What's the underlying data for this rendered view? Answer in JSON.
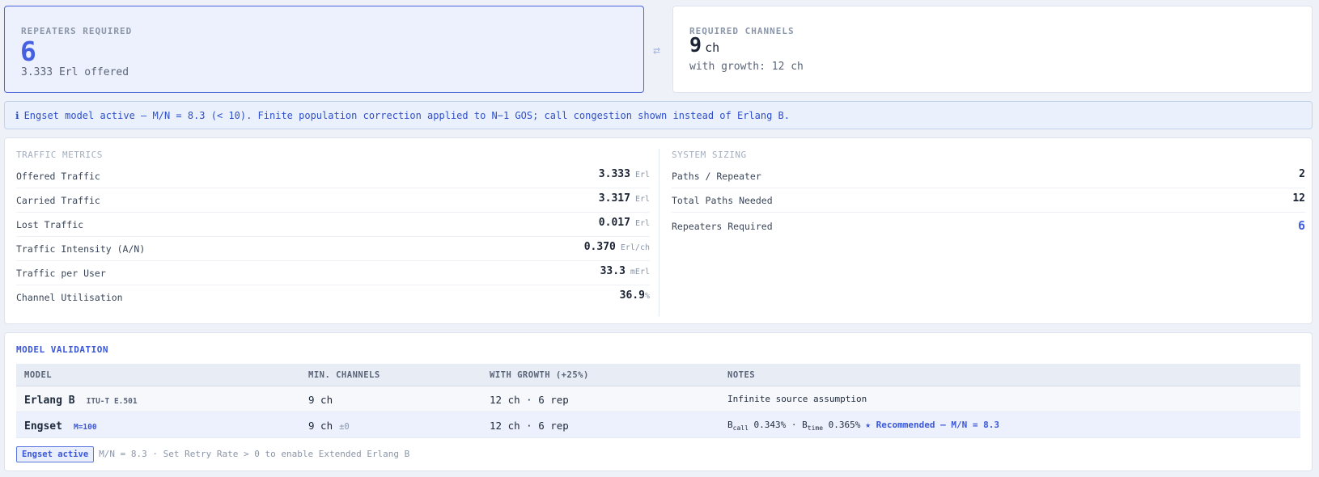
{
  "summary": {
    "repeaters_label": "REPEATERS REQUIRED",
    "repeaters_value": "6",
    "repeaters_sub": "3.333 Erl offered",
    "channels_label": "REQUIRED CHANNELS",
    "channels_value": "9",
    "channels_unit": "ch",
    "channels_sub": "with growth: 12 ch",
    "swap_glyph": "⇄"
  },
  "banner": {
    "icon": "ℹ",
    "text": "Engset model active — M/N = 8.3 (< 10). Finite population correction applied to N−1 GOS; call congestion shown instead of Erlang B."
  },
  "traffic": {
    "title": "TRAFFIC METRICS",
    "rows": [
      {
        "label": "Offered Traffic",
        "value": "3.333",
        "unit": "Erl"
      },
      {
        "label": "Carried Traffic",
        "value": "3.317",
        "unit": "Erl"
      },
      {
        "label": "Lost Traffic",
        "value": "0.017",
        "unit": "Erl"
      },
      {
        "label": "Traffic Intensity (A/N)",
        "value": "0.370",
        "unit": "Erl/ch"
      },
      {
        "label": "Traffic per User",
        "value": "33.3",
        "unit": "mErl"
      },
      {
        "label": "Channel Utilisation",
        "value": "36.9",
        "unit": "%"
      }
    ]
  },
  "sizing": {
    "title": "SYSTEM SIZING",
    "rows": [
      {
        "label": "Paths / Repeater",
        "value": "2"
      },
      {
        "label": "Total Paths Needed",
        "value": "12"
      },
      {
        "label": "Repeaters Required",
        "value": "6"
      }
    ]
  },
  "validation": {
    "title": "MODEL VALIDATION",
    "headers": [
      "MODEL",
      "MIN. CHANNELS",
      "WITH GROWTH (+25%)",
      "NOTES"
    ],
    "rows": [
      {
        "model": "Erlang B",
        "tag": "ITU-T E.501",
        "min": "9 ch",
        "min_delta": "",
        "growth": "12 ch · 6 rep",
        "note": "Infinite source assumption"
      },
      {
        "model": "Engset",
        "tag": "M=100",
        "min": "9 ch",
        "min_delta": "±0",
        "growth": "12 ch · 6 rep",
        "note_b": "B",
        "note_call_sub": "call",
        "note_call_val": "0.343%",
        "note_sep": "·",
        "note_time_sub": "time",
        "note_time_val": "0.365%",
        "recommended": "★ Recommended — M/N = 8.3"
      }
    ],
    "badge": "Engset active",
    "footer": "M/N = 8.3 · Set Retry Rate > 0 to enable Extended Erlang B"
  },
  "colors": {
    "accent": "#4560e0",
    "banner_text": "#2f4fc8",
    "muted": "#8a95a8"
  }
}
